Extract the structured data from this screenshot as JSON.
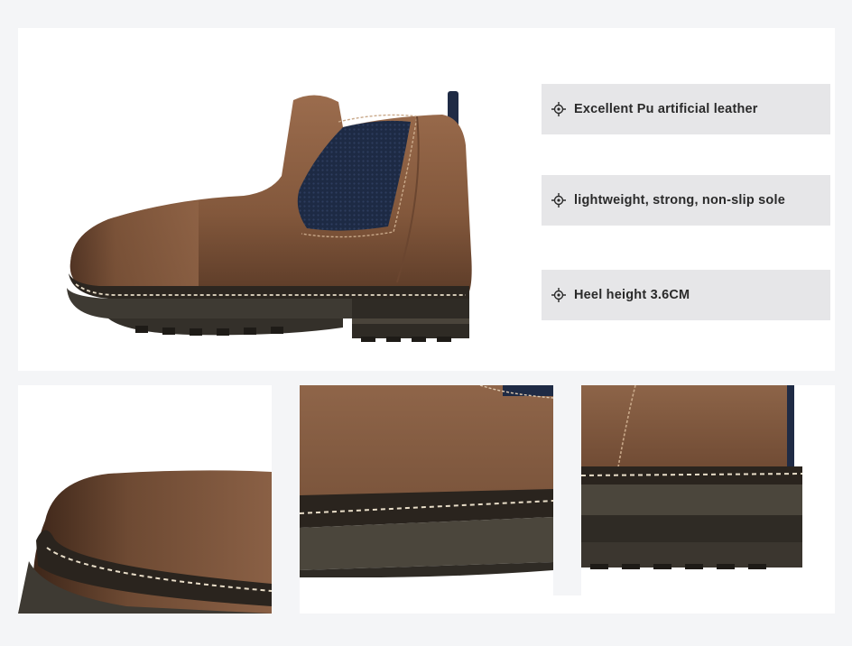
{
  "features": [
    {
      "icon": "crosshair-icon",
      "label": "Excellent Pu artificial leather"
    },
    {
      "icon": "crosshair-icon",
      "label": "lightweight, strong, non-slip sole"
    },
    {
      "icon": "crosshair-icon",
      "label": "Heel height 3.6CM"
    }
  ],
  "colors": {
    "leather": "#8a5f43",
    "leather_dark": "#5a3a28",
    "elastic": "#1f2b45",
    "sole": "#3e3a33",
    "stitch": "#e8ddc8",
    "feature_bg": "#e6e6e8"
  }
}
